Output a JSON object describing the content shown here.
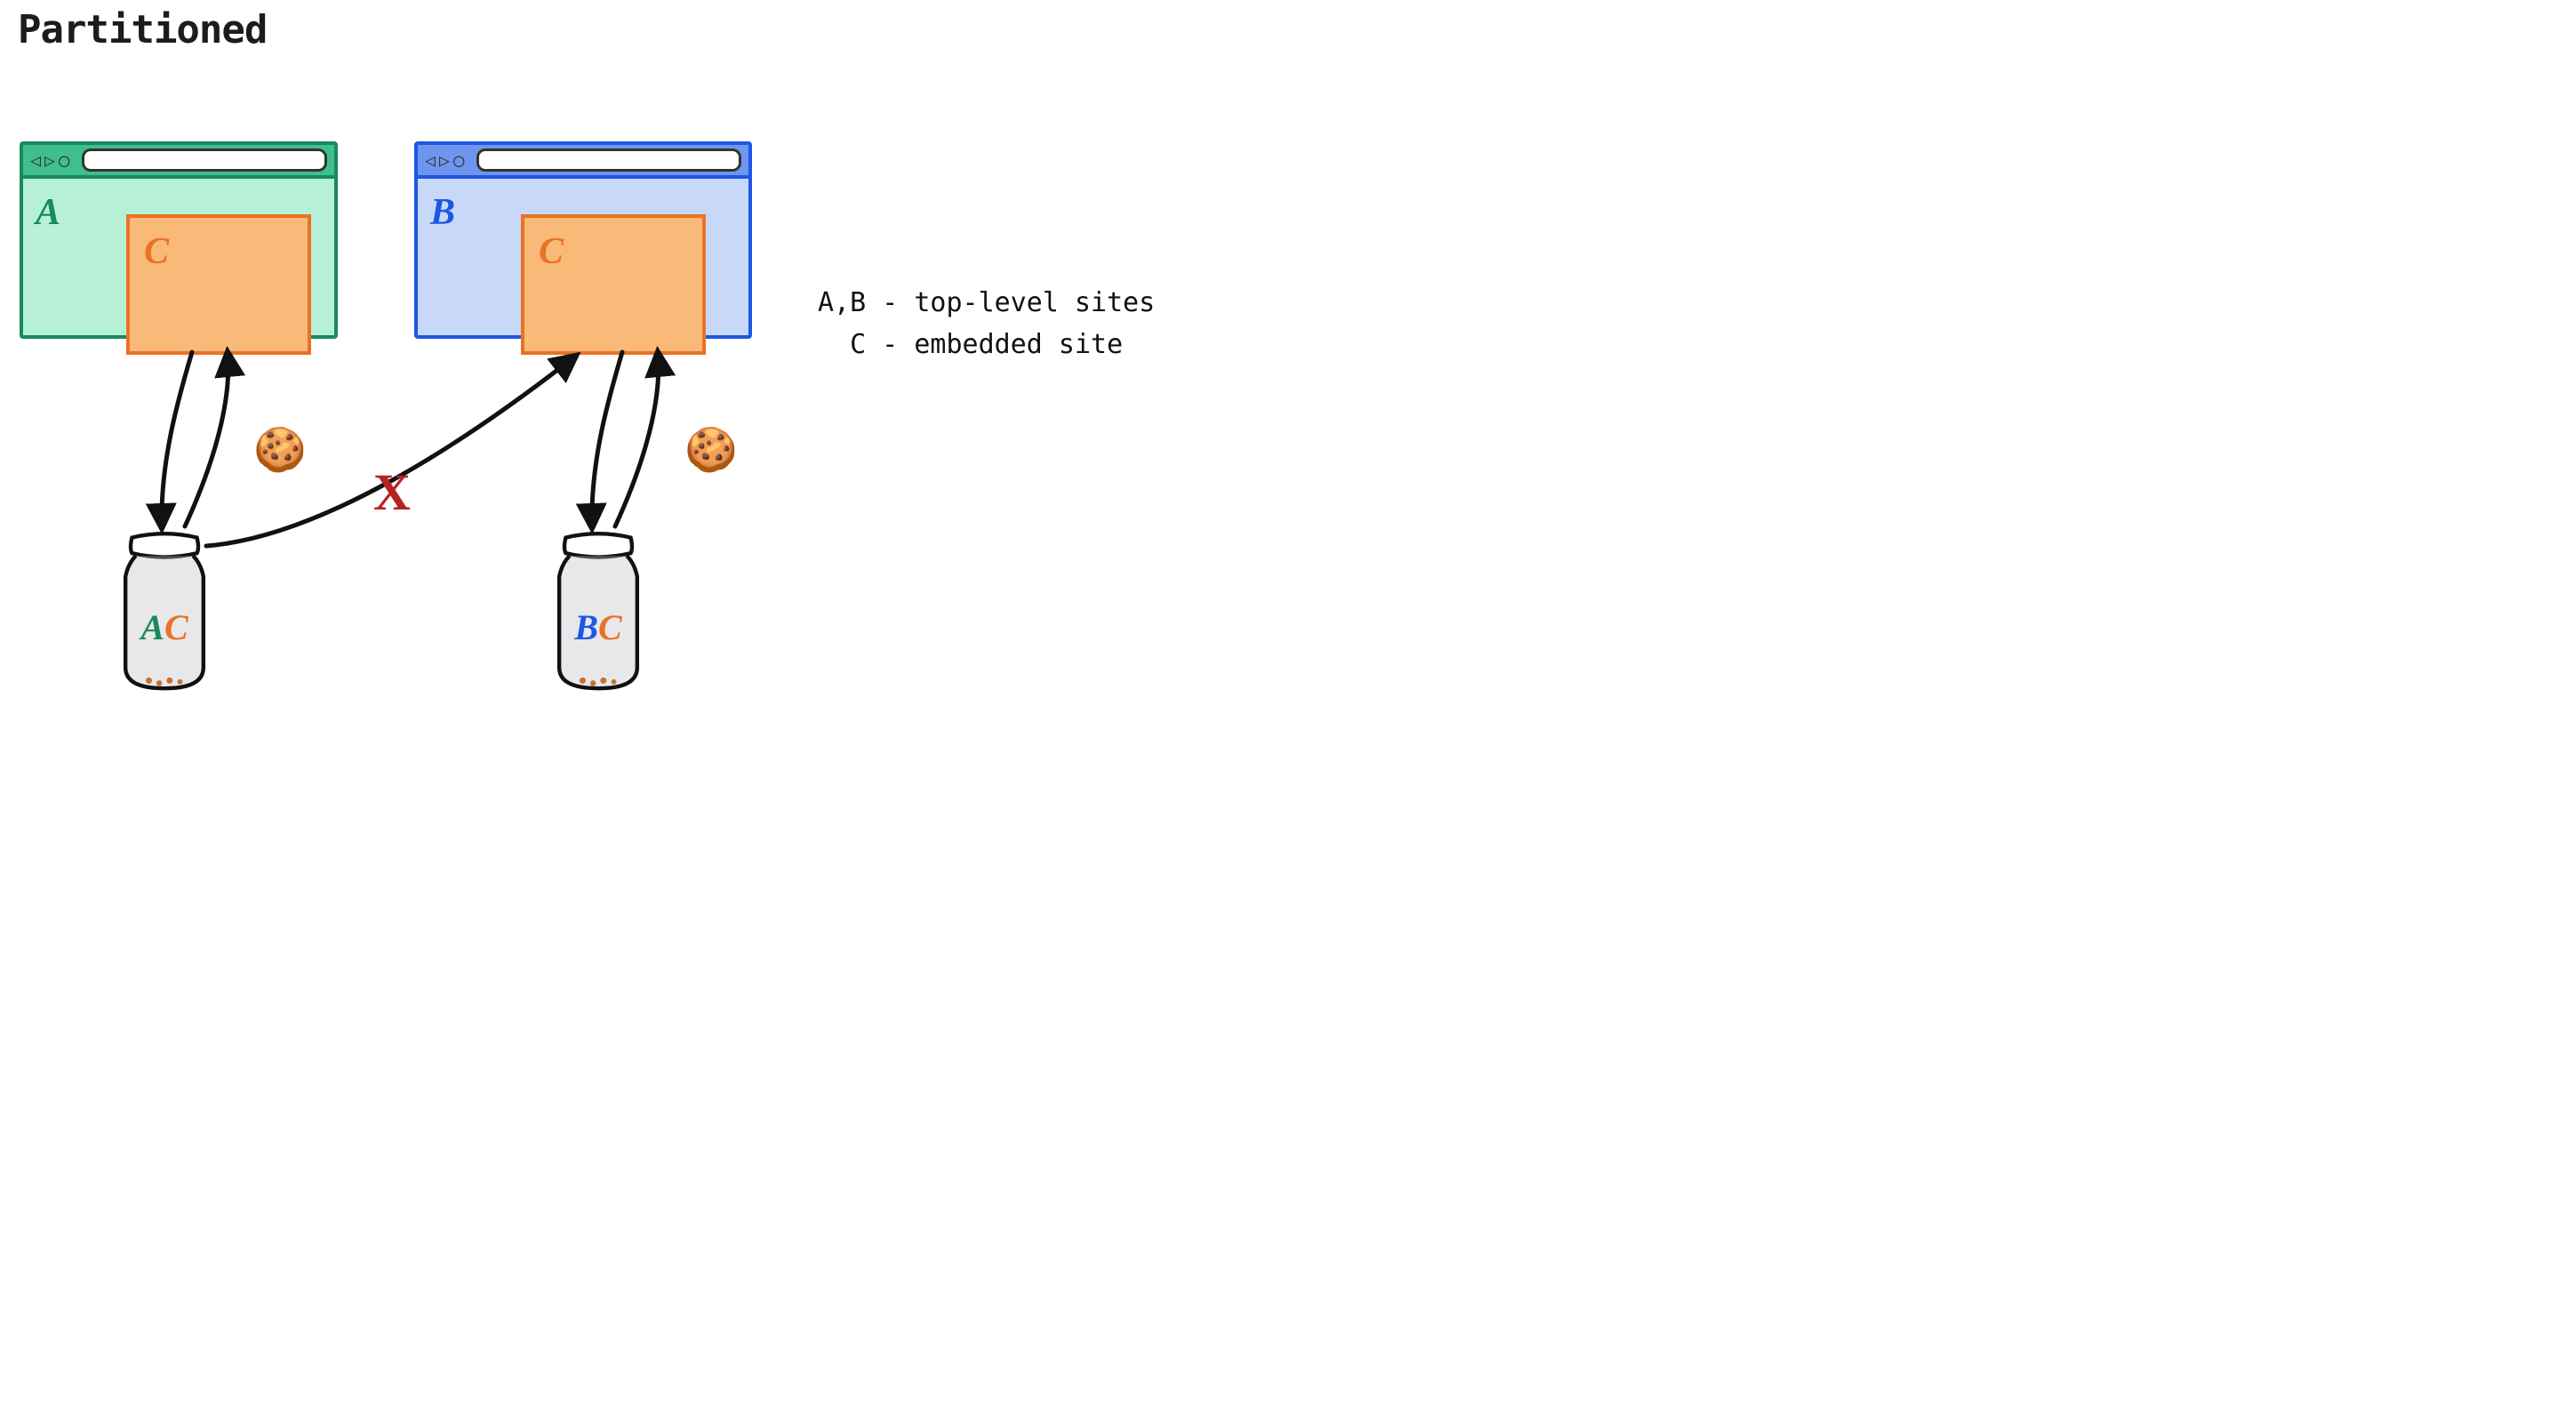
{
  "title": "Partitioned",
  "siteA": {
    "label": "A",
    "embed": "C"
  },
  "siteB": {
    "label": "B",
    "embed": "C"
  },
  "jarA": {
    "letter1": "A",
    "letter2": "C"
  },
  "jarB": {
    "letter1": "B",
    "letter2": "C"
  },
  "cookie_glyph": "🍪",
  "blocked_glyph": "X",
  "legend": {
    "line1": "A,B - top-level sites",
    "line2": "  C - embedded site"
  }
}
